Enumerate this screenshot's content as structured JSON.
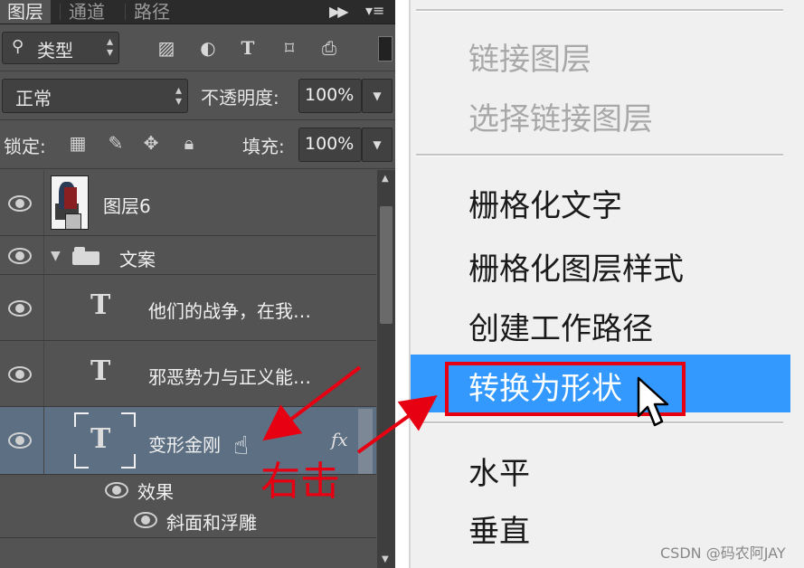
{
  "layers_panel": {
    "tabs": [
      "图层",
      "通道",
      "路径"
    ],
    "filter": {
      "label": "类型"
    },
    "blend_mode": "正常",
    "opacity": {
      "label": "不透明度:",
      "value": "100%"
    },
    "lock": {
      "label": "锁定:"
    },
    "fill": {
      "label": "填充:",
      "value": "100%"
    },
    "layers": {
      "layer6": "图层6",
      "group": "文案",
      "text1": "他们的战争，在我…",
      "text2": "邪恶势力与正义能…",
      "text3": "变形金刚",
      "fx": "fx",
      "effects": "效果",
      "bevel": "斜面和浮雕"
    }
  },
  "context_menu": {
    "link_layers": "链接图层",
    "select_linked": "选择链接图层",
    "rasterize_text": "栅格化文字",
    "rasterize_style": "栅格化图层样式",
    "create_work_path": "创建工作路径",
    "convert_to_shape": "转换为形状",
    "horizontal": "水平",
    "vertical": "垂直"
  },
  "annotation": {
    "label": "右击",
    "color": "#e60012"
  },
  "watermark": "CSDN @码农阿JAY",
  "colors": {
    "selection": "#3399ff",
    "selected_layer": "#5d6f83",
    "annotation": "#e60012"
  }
}
